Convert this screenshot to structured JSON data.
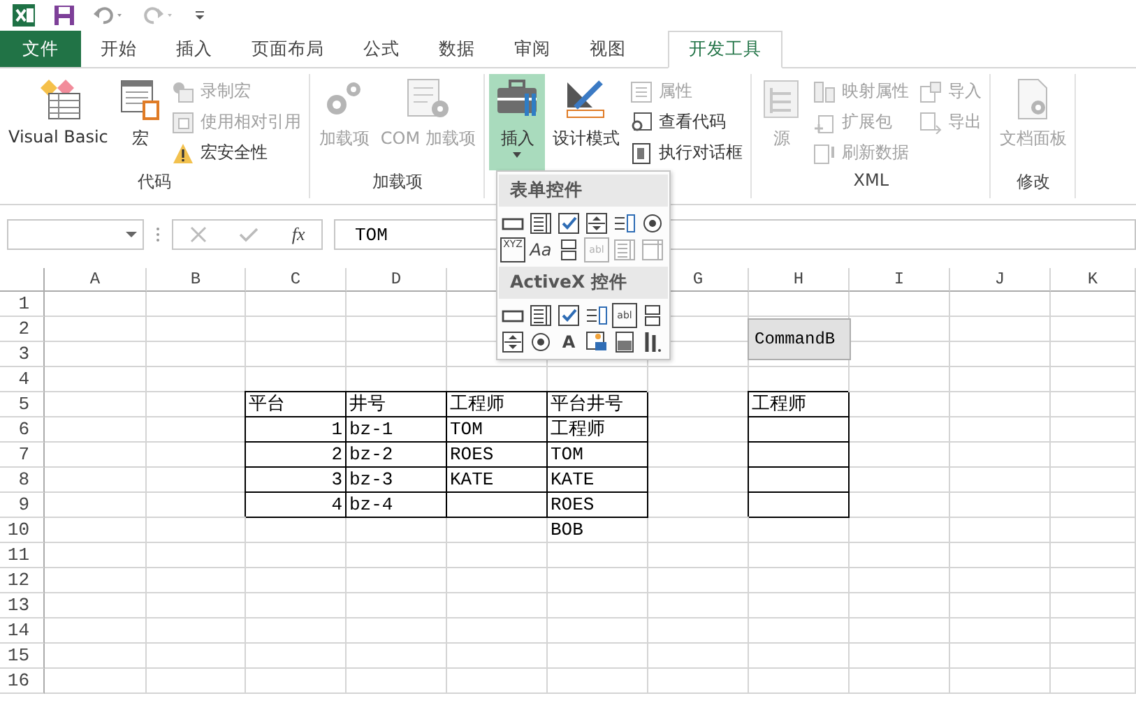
{
  "tabs": [
    {
      "label": "文件",
      "kind": "file",
      "selected": false
    },
    {
      "label": "开始",
      "kind": "tab",
      "selected": false
    },
    {
      "label": "插入",
      "kind": "tab",
      "selected": false
    },
    {
      "label": "页面布局",
      "kind": "tab",
      "selected": false
    },
    {
      "label": "公式",
      "kind": "tab",
      "selected": false
    },
    {
      "label": "数据",
      "kind": "tab",
      "selected": false
    },
    {
      "label": "审阅",
      "kind": "tab",
      "selected": false
    },
    {
      "label": "视图",
      "kind": "tab",
      "selected": false
    },
    {
      "label": "开发工具",
      "kind": "tab",
      "selected": true
    }
  ],
  "ribbon": {
    "groups": [
      {
        "label": "代码",
        "items": [
          {
            "kind": "large",
            "label": "Visual Basic",
            "disabled": false,
            "pressed": false,
            "dropdown": false
          },
          {
            "kind": "large",
            "label": "宏",
            "disabled": false,
            "pressed": false,
            "dropdown": false
          },
          {
            "kind": "stack",
            "items": [
              {
                "label": "录制宏",
                "disabled": true
              },
              {
                "label": "使用相对引用",
                "disabled": true
              },
              {
                "label": "宏安全性",
                "disabled": false
              }
            ]
          }
        ]
      },
      {
        "label": "加载项",
        "items": [
          {
            "kind": "large",
            "label": "加载项",
            "disabled": true,
            "pressed": false,
            "dropdown": false
          },
          {
            "kind": "large",
            "label": "COM 加载项",
            "disabled": true,
            "pressed": false,
            "dropdown": false
          }
        ]
      },
      {
        "items": [
          {
            "kind": "large",
            "label": "插入",
            "disabled": false,
            "pressed": true,
            "dropdown": true
          },
          {
            "kind": "large",
            "label": "设计模式",
            "disabled": false,
            "pressed": false,
            "dropdown": false
          },
          {
            "kind": "stack",
            "items": [
              {
                "label": "属性",
                "disabled": true
              },
              {
                "label": "查看代码",
                "disabled": false
              },
              {
                "label": "执行对话框",
                "disabled": false
              }
            ]
          }
        ]
      },
      {
        "label": "XML",
        "items": [
          {
            "kind": "large",
            "label": "源",
            "disabled": true,
            "pressed": false,
            "dropdown": false
          },
          {
            "kind": "stack",
            "items": [
              {
                "label": "映射属性",
                "disabled": true
              },
              {
                "label": "扩展包",
                "disabled": true
              },
              {
                "label": "刷新数据",
                "disabled": true
              }
            ]
          },
          {
            "kind": "stack",
            "items": [
              {
                "label": "导入",
                "disabled": true
              },
              {
                "label": "导出",
                "disabled": true
              }
            ]
          }
        ]
      },
      {
        "label": "修改",
        "items": [
          {
            "kind": "large",
            "label": "文档面板",
            "disabled": true,
            "pressed": false,
            "dropdown": false
          }
        ]
      }
    ]
  },
  "formula_bar": {
    "function_label": "fx",
    "value": "TOM"
  },
  "sheet": {
    "columns": [
      {
        "label": "A"
      },
      {
        "label": "B"
      },
      {
        "label": "C"
      },
      {
        "label": "D"
      },
      {},
      {},
      {
        "label": "G"
      },
      {
        "label": "H"
      },
      {
        "label": "I"
      },
      {
        "label": "J"
      },
      {
        "label": "K"
      }
    ],
    "rows": [
      {
        "number": "1"
      },
      {
        "number": "2"
      },
      {
        "number": "3"
      },
      {
        "number": "4"
      },
      {
        "number": "5",
        "cells": [
          null,
          null,
          {
            "text": "平台",
            "kind": "text",
            "bordered": true
          },
          {
            "text": "井号",
            "kind": "text",
            "bordered": true
          },
          {
            "text": "工程师",
            "kind": "text",
            "bordered": true
          },
          {
            "text": "平台井号",
            "kind": "text",
            "bordered": true
          },
          null,
          {
            "text": "工程师",
            "kind": "text",
            "bordered": true
          }
        ]
      },
      {
        "number": "6",
        "cells": [
          null,
          null,
          {
            "text": "1",
            "kind": "number",
            "bordered": true
          },
          {
            "text": "bz-1",
            "kind": "text",
            "bordered": true
          },
          {
            "text": "TOM",
            "kind": "text",
            "bordered": true
          },
          {
            "text": "工程师",
            "kind": "text",
            "bordered": true
          },
          null,
          {
            "bordered": true
          }
        ]
      },
      {
        "number": "7",
        "cells": [
          null,
          null,
          {
            "text": "2",
            "kind": "number",
            "bordered": true
          },
          {
            "text": "bz-2",
            "kind": "text",
            "bordered": true
          },
          {
            "text": "ROES",
            "kind": "text",
            "bordered": true
          },
          {
            "text": "TOM",
            "kind": "text",
            "bordered": true
          },
          null,
          {
            "bordered": true
          }
        ]
      },
      {
        "number": "8",
        "cells": [
          null,
          null,
          {
            "text": "3",
            "kind": "number",
            "bordered": true
          },
          {
            "text": "bz-3",
            "kind": "text",
            "bordered": true
          },
          {
            "text": "KATE",
            "kind": "text",
            "bordered": true
          },
          {
            "text": "KATE",
            "kind": "text",
            "bordered": true
          },
          null,
          {
            "bordered": true
          }
        ]
      },
      {
        "number": "9",
        "cells": [
          null,
          null,
          {
            "text": "4",
            "kind": "number",
            "bordered": true
          },
          {
            "text": "bz-4",
            "kind": "text",
            "bordered": true
          },
          {
            "bordered": true
          },
          {
            "text": "ROES",
            "kind": "text",
            "bordered": true
          },
          null,
          {
            "bordered": true
          }
        ]
      },
      {
        "number": "10",
        "cells": [
          null,
          null,
          null,
          null,
          null,
          {
            "text": "BOB",
            "kind": "text",
            "bordered": false
          }
        ]
      },
      {
        "number": "11"
      },
      {
        "number": "12"
      },
      {
        "number": "13"
      },
      {
        "number": "14"
      },
      {
        "number": "15"
      },
      {
        "number": "16"
      }
    ]
  },
  "command_button": {
    "label": "CommandB"
  },
  "insert_menu": {
    "sections": [
      {
        "title": "表单控件",
        "controls": [
          {
            "kind": "button",
            "disabled": false
          },
          {
            "kind": "combo",
            "disabled": false
          },
          {
            "kind": "checkbox",
            "disabled": false
          },
          {
            "kind": "spin",
            "disabled": false
          },
          {
            "kind": "listbox",
            "disabled": false
          },
          {
            "kind": "radio",
            "disabled": false
          },
          {
            "kind": "group",
            "glyph": "XYZ",
            "disabled": false
          },
          {
            "kind": "label",
            "glyph": "Aa",
            "disabled": false
          },
          {
            "kind": "scroll",
            "disabled": false
          },
          {
            "kind": "textfield",
            "glyph": "abl",
            "disabled": true
          },
          {
            "kind": "combolist",
            "disabled": true
          },
          {
            "kind": "combodrop",
            "disabled": true
          }
        ]
      },
      {
        "title": "ActiveX 控件",
        "controls": [
          {
            "kind": "button",
            "disabled": false
          },
          {
            "kind": "combo",
            "disabled": false
          },
          {
            "kind": "checkbox",
            "disabled": false
          },
          {
            "kind": "listbox",
            "disabled": false
          },
          {
            "kind": "textfield",
            "glyph": "abl",
            "disabled": false
          },
          {
            "kind": "scroll",
            "disabled": false
          },
          {
            "kind": "spin",
            "disabled": false
          },
          {
            "kind": "radio",
            "disabled": false
          },
          {
            "kind": "label",
            "glyph": "A",
            "disabled": false
          },
          {
            "kind": "image",
            "disabled": false
          },
          {
            "kind": "toggle",
            "disabled": false
          },
          {
            "kind": "tools",
            "disabled": false
          }
        ]
      }
    ]
  }
}
